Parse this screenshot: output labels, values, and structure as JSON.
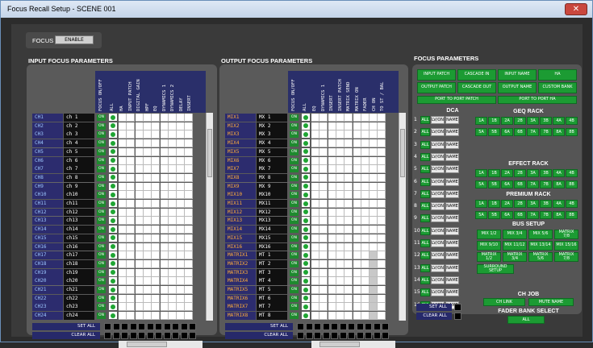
{
  "window": {
    "title": "Focus Recall Setup - SCENE 001",
    "close": "✕"
  },
  "focus": {
    "label": "FOCUS",
    "enable": "ENABLE"
  },
  "input": {
    "title": "INPUT FOCUS PARAMETERS",
    "headers": [
      "FOCUS ON/OFF",
      "ALL",
      "HA",
      "INPUT PATCH",
      "DIGITAL GAIN",
      "HPF",
      "EQ",
      "DYNAMICS 1",
      "DYNAMICS 2",
      "DELAY",
      "INSERT"
    ],
    "rows": [
      [
        "CH1",
        "ch 1"
      ],
      [
        "CH2",
        "ch 2"
      ],
      [
        "CH3",
        "ch 3"
      ],
      [
        "CH4",
        "ch 4"
      ],
      [
        "CH5",
        "ch 5"
      ],
      [
        "CH6",
        "ch 6"
      ],
      [
        "CH7",
        "ch 7"
      ],
      [
        "CH8",
        "ch 8"
      ],
      [
        "CH9",
        "ch 9"
      ],
      [
        "CH10",
        "ch10"
      ],
      [
        "CH11",
        "ch11"
      ],
      [
        "CH12",
        "ch12"
      ],
      [
        "CH13",
        "ch13"
      ],
      [
        "CH14",
        "ch14"
      ],
      [
        "CH15",
        "ch15"
      ],
      [
        "CH16",
        "ch16"
      ],
      [
        "CH17",
        "ch17"
      ],
      [
        "CH18",
        "ch18"
      ],
      [
        "CH19",
        "ch19"
      ],
      [
        "CH20",
        "ch20"
      ],
      [
        "CH21",
        "ch21"
      ],
      [
        "CH22",
        "ch22"
      ],
      [
        "CH23",
        "ch23"
      ],
      [
        "CH24",
        "ch24"
      ]
    ],
    "set_all": "SET ALL",
    "clear_all": "CLEAR ALL",
    "on": "ON"
  },
  "output": {
    "title": "OUTPUT FOCUS PARAMETERS",
    "headers": [
      "FOCUS ON/OFF",
      "ALL",
      "EQ",
      "DYNAMICS 1",
      "INSERT",
      "INSERT PATCH",
      "MATRIX SEND",
      "MATRIX ON",
      "FADER",
      "CH ON",
      "TO ST / BAL"
    ],
    "rows": [
      [
        "MIX1",
        "MX 1"
      ],
      [
        "MIX2",
        "MX 2"
      ],
      [
        "MIX3",
        "MX 3"
      ],
      [
        "MIX4",
        "MX 4"
      ],
      [
        "MIX5",
        "MX 5"
      ],
      [
        "MIX6",
        "MX 6"
      ],
      [
        "MIX7",
        "MX 7"
      ],
      [
        "MIX8",
        "MX 8"
      ],
      [
        "MIX9",
        "MX 9"
      ],
      [
        "MIX10",
        "MX10"
      ],
      [
        "MIX11",
        "MX11"
      ],
      [
        "MIX12",
        "MX12"
      ],
      [
        "MIX13",
        "MX13"
      ],
      [
        "MIX14",
        "MX14"
      ],
      [
        "MIX15",
        "MX15"
      ],
      [
        "MIX16",
        "MX16"
      ],
      [
        "MATRIX1",
        "MT 1"
      ],
      [
        "MATRIX2",
        "MT 2"
      ],
      [
        "MATRIX3",
        "MT 3"
      ],
      [
        "MATRIX4",
        "MT 4"
      ],
      [
        "MATRIX5",
        "MT 5"
      ],
      [
        "MATRIX6",
        "MT 6"
      ],
      [
        "MATRIX7",
        "MT 7"
      ],
      [
        "MATRIX8",
        "MT 8"
      ]
    ],
    "set_all": "SET ALL",
    "clear_all": "CLEAR ALL"
  },
  "fp": {
    "title": "FOCUS PARAMETERS",
    "top": [
      [
        "INPUT PATCH",
        "CASCADE IN",
        "INPUT NAME",
        "HA"
      ],
      [
        "OUTPUT PATCH",
        "CASCADE OUT",
        "OUTPUT NAME",
        "CUSTOM BANK"
      ]
    ],
    "p2p": [
      "PORT TO PORT PATCH",
      "PORT TO PORT HA"
    ],
    "dca": "DCA",
    "dca_all": "ALL",
    "dca_lv": "LV/ON",
    "dca_name": "NAME",
    "dca_nums": [
      "1",
      "2",
      "3",
      "4",
      "5",
      "6",
      "7",
      "8",
      "9",
      "10",
      "11",
      "12",
      "13",
      "14",
      "15",
      "16"
    ],
    "geq": "GEQ RACK",
    "effect": "EFFECT RACK",
    "premium": "PREMIUM RACK",
    "rack_r1": [
      "1A",
      "1B",
      "2A",
      "2B",
      "3A",
      "3B",
      "4A",
      "4B"
    ],
    "rack_r2": [
      "5A",
      "5B",
      "6A",
      "6B",
      "7A",
      "7B",
      "8A",
      "8B"
    ],
    "bus": "BUS SETUP",
    "bus_r1": [
      "MIX 1/2",
      "MIX 3/4",
      "MIX 5/6",
      "MATRIX 7/8"
    ],
    "bus_r2": [
      "MIX 9/10",
      "MIX 11/12",
      "MIX 13/14",
      "MIX 15/16"
    ],
    "bus_r3": [
      "MATRIX 1/2",
      "MATRIX 3/4",
      "MATRIX 5/6",
      "MATRIX 7/8"
    ],
    "surround": "SURROUND SETUP",
    "chjob": "CH JOB",
    "ch_link": "CH LINK",
    "mute_name": "MUTE NAME",
    "fbs": "FADER BANK SELECT",
    "fbs_all": "ALL",
    "set_all": "SET ALL",
    "clear_all": "CLEAR ALL"
  }
}
